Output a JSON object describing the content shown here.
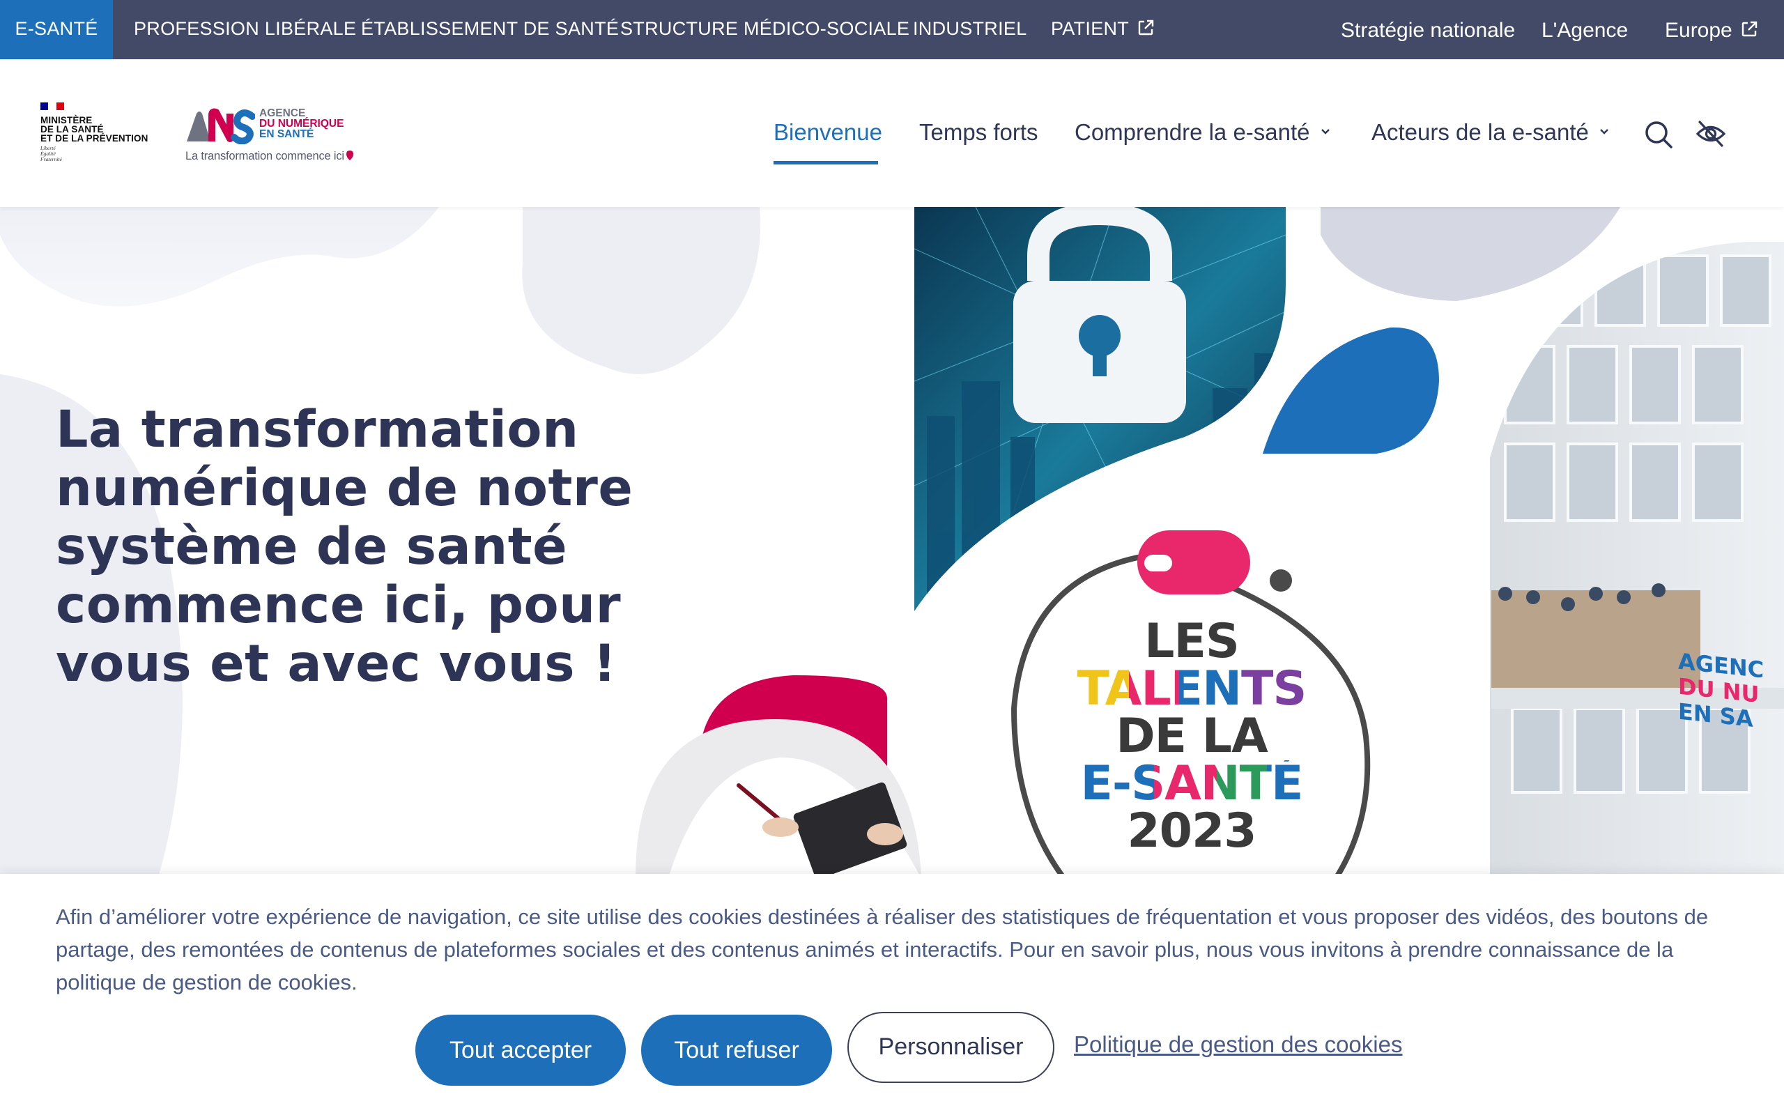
{
  "audience_bar": {
    "items": [
      {
        "label": "E-SANTÉ",
        "active": true
      },
      {
        "label": "PROFESSION LIBÉRALE",
        "active": false
      },
      {
        "label": "ÉTABLISSEMENT DE SANTÉ",
        "active": false
      },
      {
        "label": "STRUCTURE MÉDICO-SOCIALE",
        "active": false
      },
      {
        "label": "INDUSTRIEL",
        "active": false
      },
      {
        "label": "PATIENT",
        "active": false,
        "icon": "external-link-icon"
      }
    ],
    "utility_links": [
      {
        "label": "Stratégie nationale"
      },
      {
        "label": "L'Agence"
      },
      {
        "label": "Europe",
        "icon": "external-link-icon"
      }
    ]
  },
  "header": {
    "ministry_logo": {
      "line1": "MINISTÈRE",
      "line2": "DE LA SANTÉ",
      "line3": "ET DE LA PRÉVENTION",
      "motto1": "Liberté",
      "motto2": "Égalité",
      "motto3": "Fraternité"
    },
    "ans_logo": {
      "line1": "AGENCE",
      "line2": "DU NUMÉRIQUE",
      "line3": "EN SANTÉ",
      "tagline": "La transformation commence ici"
    },
    "nav": [
      {
        "label": "Bienvenue",
        "active": true
      },
      {
        "label": "Temps forts",
        "active": false
      },
      {
        "label": "Comprendre la e-santé",
        "active": false,
        "has_dropdown": true
      },
      {
        "label": "Acteurs de la e-santé",
        "active": false,
        "has_dropdown": true
      }
    ],
    "icons": [
      "search-icon",
      "eye-slash-icon"
    ]
  },
  "hero": {
    "title": "La transformation numérique de notre système de santé commence ici, pour vous et avec vous !",
    "badge": {
      "line1": "LES",
      "line2": "TALENTS",
      "line3": "DE LA",
      "line4": "E-SANTÉ",
      "line5": "2023"
    },
    "building_sign": {
      "line1": "AGENC",
      "line2": "DU NU",
      "line3": "EN SA"
    }
  },
  "cookie_banner": {
    "text": "Afin d’améliorer votre expérience de navigation, ce site utilise des cookies destinées à réaliser des statistiques de fréquentation et vous proposer des vidéos, des boutons de partage, des remontées de contenus de plateformes sociales et des contenus animés et interactifs. Pour en savoir plus, nous vous invitons à prendre connaissance de la politique de gestion de cookies.",
    "accept_label": "Tout accepter",
    "refuse_label": "Tout refuser",
    "customize_label": "Personnaliser",
    "policy_link": "Politique de gestion des cookies"
  },
  "colors": {
    "primary_blue": "#1c6fb8",
    "top_bar": "#434a68",
    "brand_pink": "#d0004e",
    "title_text": "#2e3456",
    "body_text": "#4a5a86"
  }
}
